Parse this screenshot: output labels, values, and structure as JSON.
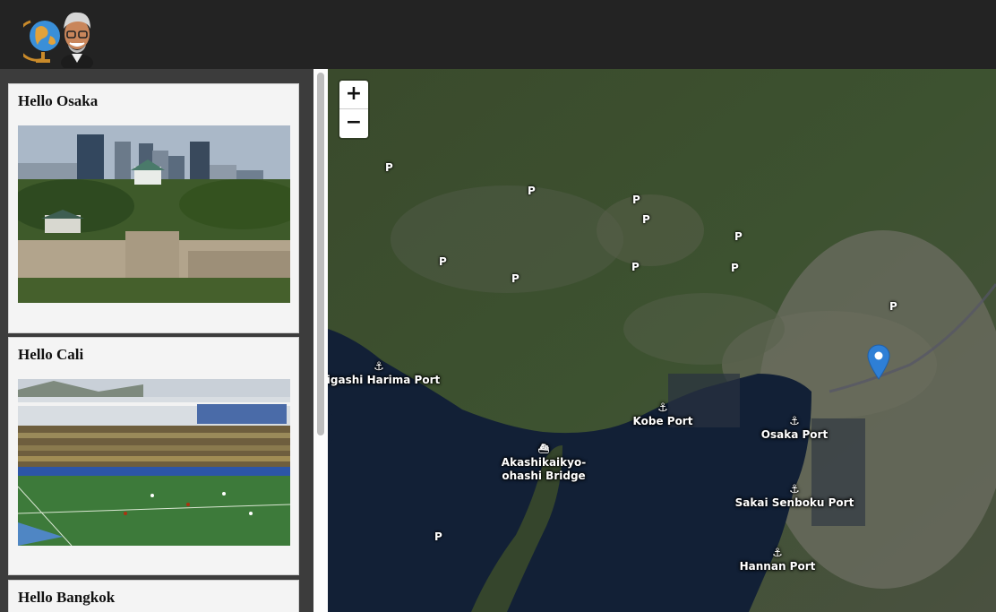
{
  "header": {
    "logo_icon": "globe-with-avatar-logo"
  },
  "sidebar": {
    "cards": [
      {
        "title": "Hello Osaka",
        "image": "osaka-castle-skyline-photo"
      },
      {
        "title": "Hello Cali",
        "image": "soccer-stadium-photo"
      },
      {
        "title": "Hello Bangkok",
        "image": ""
      }
    ]
  },
  "map": {
    "zoom_in": "+",
    "zoom_out": "−",
    "parking_symbol": "P",
    "anchor_symbol": "⚓",
    "bridge_symbol": "⛴",
    "labels": {
      "higashi_harima_port": "Higashi Harima Port",
      "kobe_port": "Kobe Port",
      "osaka_port": "Osaka Port",
      "akashi_bridge_line1": "Akashikaikyo-",
      "akashi_bridge_line2": "ohashi Bridge",
      "sakai_senboku_port": "Sakai Senboku Port",
      "hannan_port": "Hannan Port"
    },
    "marker_color": "#2e7fd6"
  }
}
